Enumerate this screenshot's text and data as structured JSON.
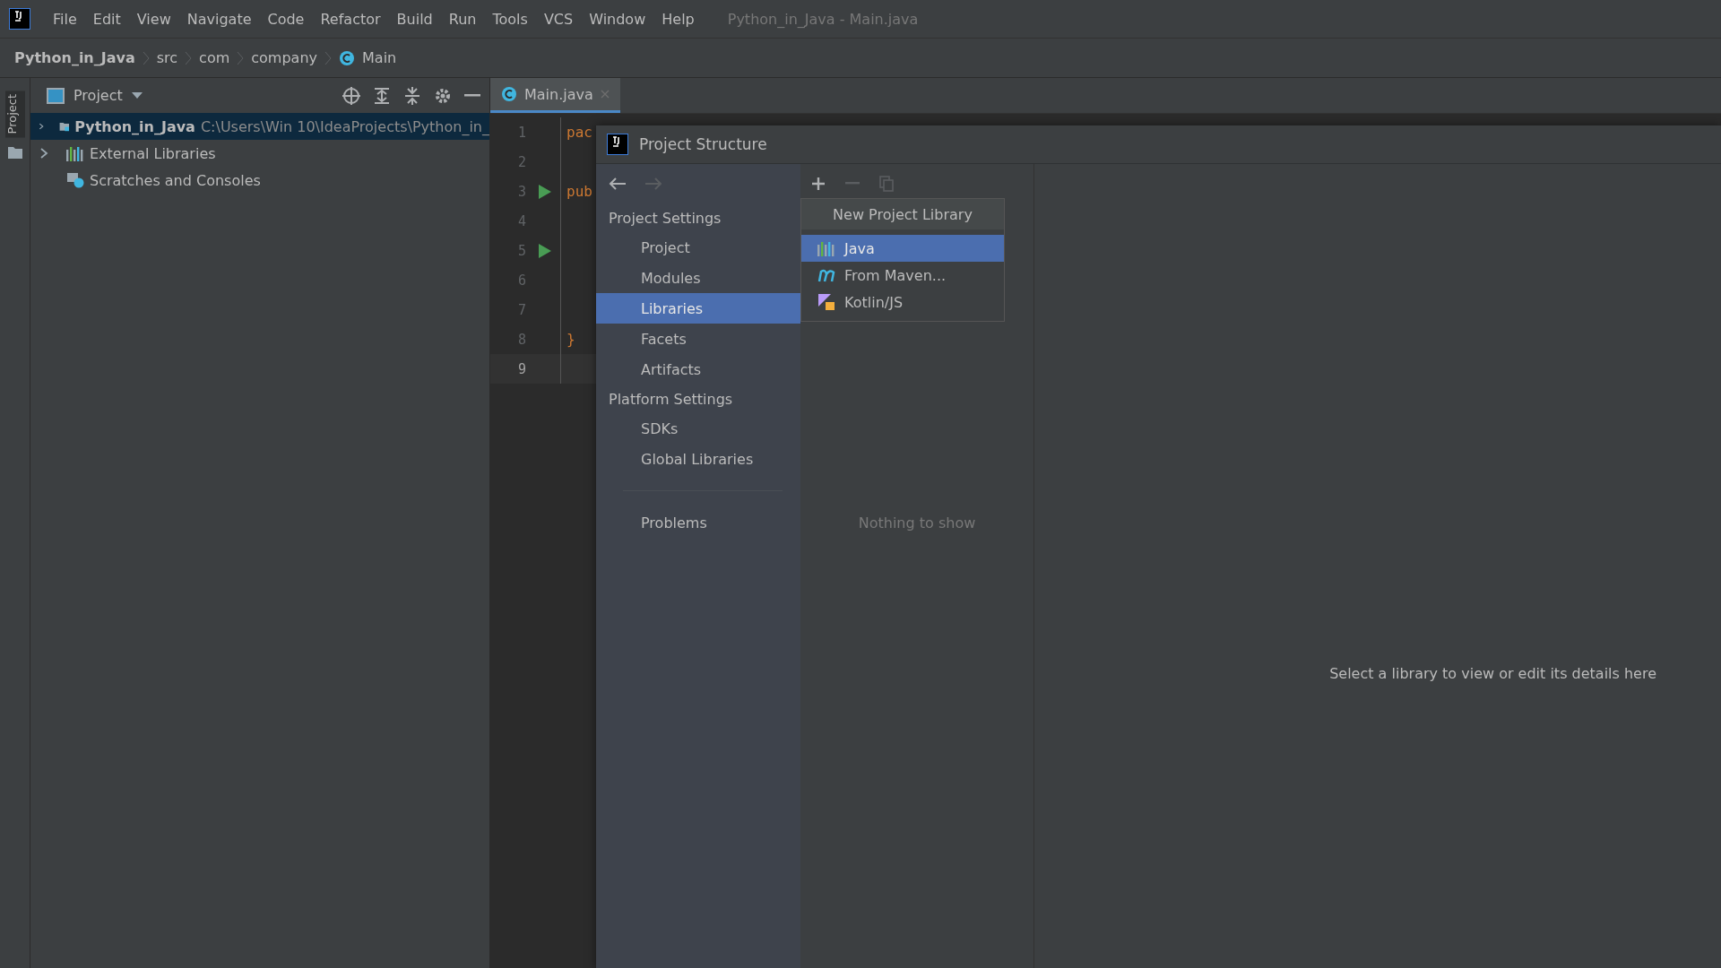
{
  "menu_bar": {
    "items": [
      "File",
      "Edit",
      "View",
      "Navigate",
      "Code",
      "Refactor",
      "Build",
      "Run",
      "Tools",
      "VCS",
      "Window",
      "Help"
    ],
    "title": "Python_in_Java - Main.java"
  },
  "breadcrumbs": [
    "Python_in_Java",
    "src",
    "com",
    "company",
    "Main"
  ],
  "side_strip": {
    "label": "Project"
  },
  "project_panel": {
    "title": "Project",
    "tree": [
      {
        "label": "Python_in_Java",
        "path": "C:\\Users\\Win 10\\IdeaProjects\\Python_in_",
        "kind": "project",
        "selected": true,
        "expanded": false
      },
      {
        "label": "External Libraries",
        "kind": "libraries",
        "selected": false,
        "expanded": false
      },
      {
        "label": "Scratches and Consoles",
        "kind": "scratches",
        "selected": false
      }
    ]
  },
  "editor": {
    "tab": "Main.java",
    "lines": [
      {
        "number": "1",
        "code": "pac",
        "run": false,
        "current": false
      },
      {
        "number": "2",
        "run": false,
        "current": false
      },
      {
        "number": "3",
        "code": "pub",
        "run": true,
        "current": false
      },
      {
        "number": "4",
        "run": false,
        "current": false
      },
      {
        "number": "5",
        "run": true,
        "current": false
      },
      {
        "number": "6",
        "run": false,
        "current": false
      },
      {
        "number": "7",
        "run": false,
        "current": false
      },
      {
        "number": "8",
        "code": "}",
        "run": false,
        "current": false
      },
      {
        "number": "9",
        "run": false,
        "current": true
      }
    ]
  },
  "dialog": {
    "title": "Project Structure",
    "nav": [
      {
        "kind": "header",
        "label": "Project Settings"
      },
      {
        "kind": "item",
        "label": "Project",
        "selected": false
      },
      {
        "kind": "item",
        "label": "Modules",
        "selected": false
      },
      {
        "kind": "item",
        "label": "Libraries",
        "selected": true
      },
      {
        "kind": "item",
        "label": "Facets",
        "selected": false
      },
      {
        "kind": "item",
        "label": "Artifacts",
        "selected": false
      },
      {
        "kind": "header",
        "label": "Platform Settings"
      },
      {
        "kind": "item",
        "label": "SDKs",
        "selected": false
      },
      {
        "kind": "item",
        "label": "Global Libraries",
        "selected": false
      },
      {
        "kind": "separator"
      },
      {
        "kind": "item",
        "label": "Problems",
        "selected": false
      }
    ],
    "empty_text": "Nothing to show",
    "details_hint": "Select a library to view or edit its details here",
    "popup": {
      "title": "New Project Library",
      "items": [
        {
          "label": "Java",
          "kind": "java",
          "selected": true
        },
        {
          "label": "From Maven...",
          "kind": "maven",
          "selected": false
        },
        {
          "label": "Kotlin/JS",
          "kind": "kotlin",
          "selected": false
        }
      ]
    }
  }
}
